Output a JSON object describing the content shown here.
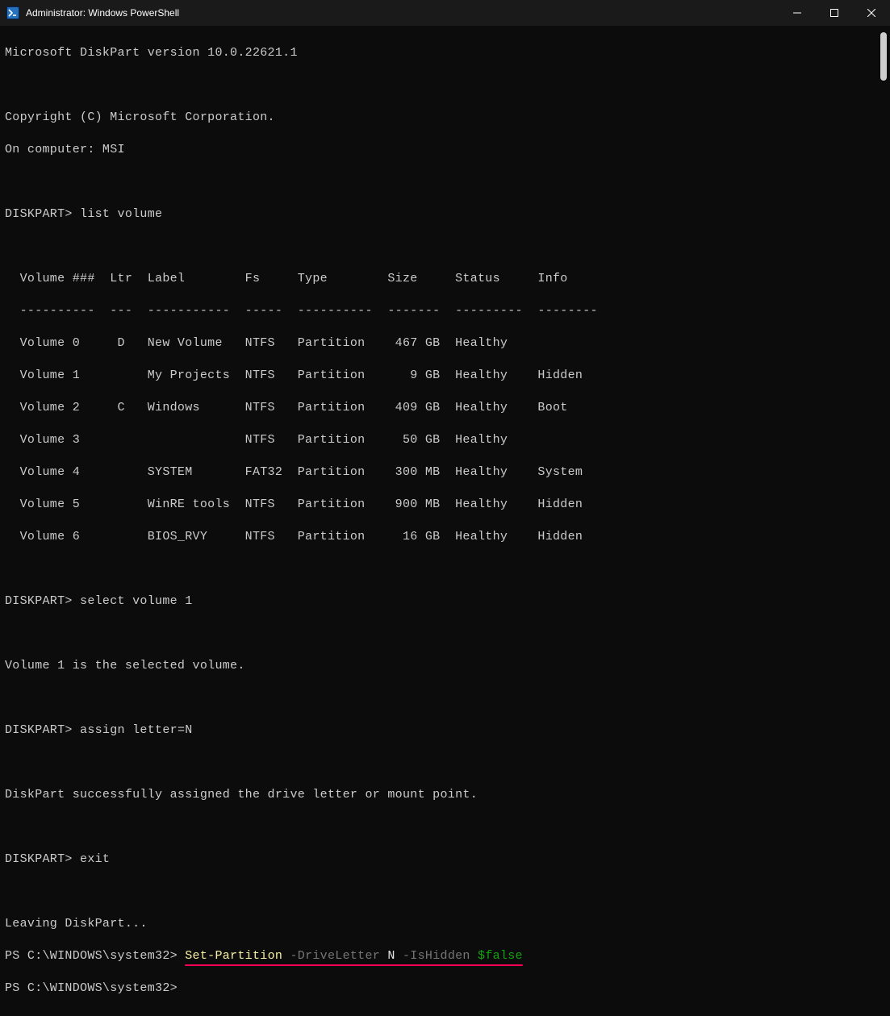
{
  "titlebar": {
    "title": "Administrator: Windows PowerShell"
  },
  "header": {
    "version_line": "Microsoft DiskPart version 10.0.22621.1",
    "copyright": "Copyright (C) Microsoft Corporation.",
    "computer": "On computer: MSI"
  },
  "prompts": {
    "diskpart": "DISKPART>",
    "ps": "PS C:\\WINDOWS\\system32>"
  },
  "commands": {
    "list_volume": " list volume",
    "select_volume": " select volume 1",
    "assign_letter": " assign letter=N",
    "exit": " exit"
  },
  "table": {
    "header": "  Volume ###  Ltr  Label        Fs     Type        Size     Status     Info",
    "divider": "  ----------  ---  -----------  -----  ----------  -------  ---------  --------",
    "rows": [
      "  Volume 0     D   New Volume   NTFS   Partition    467 GB  Healthy",
      "  Volume 1         My Projects  NTFS   Partition      9 GB  Healthy    Hidden",
      "  Volume 2     C   Windows      NTFS   Partition    409 GB  Healthy    Boot",
      "  Volume 3                      NTFS   Partition     50 GB  Healthy",
      "  Volume 4         SYSTEM       FAT32  Partition    300 MB  Healthy    System",
      "  Volume 5         WinRE tools  NTFS   Partition    900 MB  Healthy    Hidden",
      "  Volume 6         BIOS_RVY     NTFS   Partition     16 GB  Healthy    Hidden"
    ]
  },
  "messages": {
    "selected": "Volume 1 is the selected volume.",
    "assigned": "DiskPart successfully assigned the drive letter or mount point.",
    "leaving": "Leaving DiskPart..."
  },
  "ps_command": {
    "cmdlet": "Set-Partition",
    "param1": " -DriveLetter",
    "arg1": " N",
    "param2": " -IsHidden",
    "arg2": " $false"
  },
  "chart_data": {
    "type": "table",
    "title": "DiskPart list volume",
    "columns": [
      "Volume ###",
      "Ltr",
      "Label",
      "Fs",
      "Type",
      "Size",
      "Status",
      "Info"
    ],
    "rows": [
      {
        "volume": 0,
        "ltr": "D",
        "label": "New Volume",
        "fs": "NTFS",
        "type": "Partition",
        "size": "467 GB",
        "status": "Healthy",
        "info": ""
      },
      {
        "volume": 1,
        "ltr": "",
        "label": "My Projects",
        "fs": "NTFS",
        "type": "Partition",
        "size": "9 GB",
        "status": "Healthy",
        "info": "Hidden"
      },
      {
        "volume": 2,
        "ltr": "C",
        "label": "Windows",
        "fs": "NTFS",
        "type": "Partition",
        "size": "409 GB",
        "status": "Healthy",
        "info": "Boot"
      },
      {
        "volume": 3,
        "ltr": "",
        "label": "",
        "fs": "NTFS",
        "type": "Partition",
        "size": "50 GB",
        "status": "Healthy",
        "info": ""
      },
      {
        "volume": 4,
        "ltr": "",
        "label": "SYSTEM",
        "fs": "FAT32",
        "type": "Partition",
        "size": "300 MB",
        "status": "Healthy",
        "info": "System"
      },
      {
        "volume": 5,
        "ltr": "",
        "label": "WinRE tools",
        "fs": "NTFS",
        "type": "Partition",
        "size": "900 MB",
        "status": "Healthy",
        "info": "Hidden"
      },
      {
        "volume": 6,
        "ltr": "",
        "label": "BIOS_RVY",
        "fs": "NTFS",
        "type": "Partition",
        "size": "16 GB",
        "status": "Healthy",
        "info": "Hidden"
      }
    ]
  }
}
